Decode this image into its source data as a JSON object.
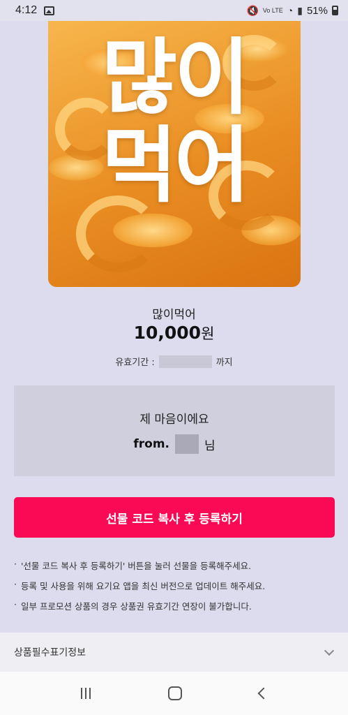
{
  "status_bar": {
    "time": "4:12",
    "network": "Vo LTE",
    "battery": "51%",
    "icons": [
      "image-icon",
      "mute-icon",
      "wifi-icon",
      "signal-icon",
      "battery-icon"
    ]
  },
  "product": {
    "image_text_line1": "많이",
    "image_text_line2": "먹어",
    "name": "많이먹어",
    "price_amount": "10,000",
    "price_unit": "원",
    "validity_label": "유효기간 :",
    "validity_suffix": "까지"
  },
  "message": {
    "text": "제 마음이에요",
    "from_prefix": "from.",
    "from_suffix": "님"
  },
  "cta": {
    "label": "선물 코드 복사 후 등록하기",
    "color": "#fa0a55"
  },
  "notes": [
    "'선물 코드 복사 후 등록하기' 버튼을 눌러 선물을 등록해주세요.",
    "등록 및 사용을 위해 요기요 앱을 최신 버전으로 업데이트 해주세요.",
    "일부 프로모션 상품의 경우 상품권 유효기간 연장이 불가합니다."
  ],
  "info_section": {
    "label": "상품필수표기정보"
  },
  "nav_bar": {
    "icons": [
      "recent-apps-icon",
      "home-icon",
      "back-icon"
    ]
  }
}
